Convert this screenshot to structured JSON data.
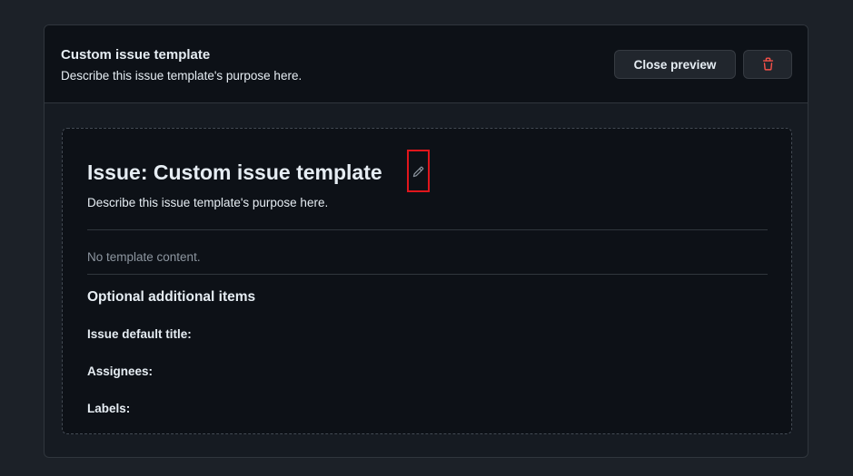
{
  "template": {
    "name": "Custom issue template",
    "description": "Describe this issue template's purpose here."
  },
  "header_actions": {
    "close_preview_label": "Close preview",
    "delete_icon": "trash-icon",
    "delete_icon_color": "#f85149"
  },
  "preview": {
    "title": "Issue: Custom issue template",
    "edit_icon": "pencil-icon",
    "description": "Describe this issue template's purpose here.",
    "empty_content": "No template content.",
    "optional_heading": "Optional additional items",
    "fields": {
      "default_title_label": "Issue default title:",
      "assignees_label": "Assignees:",
      "labels_label": "Labels:"
    }
  },
  "colors": {
    "highlight_border": "#e0161c",
    "background": "#1c2128",
    "panel": "#0d1117"
  }
}
